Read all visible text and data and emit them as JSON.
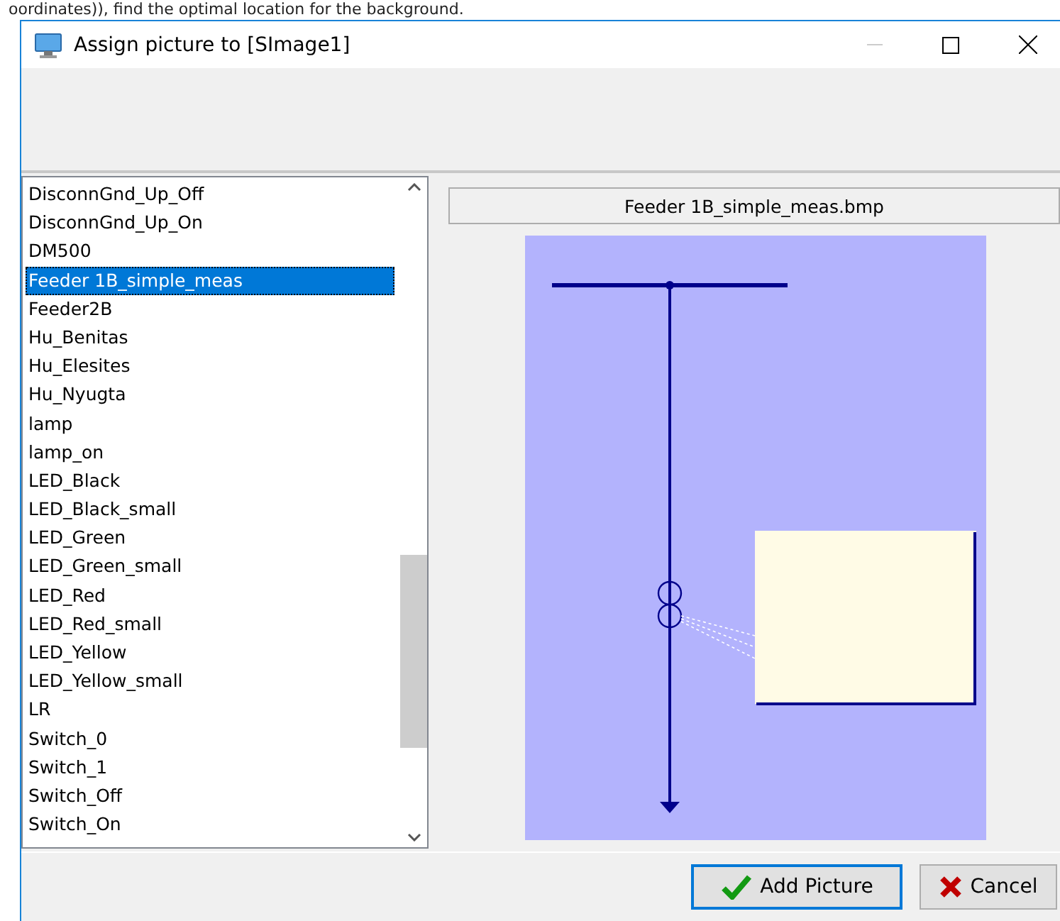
{
  "background_text": "oordinates)), find the optimal location for the background.",
  "window": {
    "title": "Assign picture to [SImage1]"
  },
  "picture_list": {
    "items": [
      {
        "label": "DisconnGnd_Up_Off",
        "selected": false
      },
      {
        "label": "DisconnGnd_Up_On",
        "selected": false
      },
      {
        "label": "DM500",
        "selected": false
      },
      {
        "label": "Feeder 1B_simple_meas",
        "selected": true
      },
      {
        "label": "Feeder2B",
        "selected": false
      },
      {
        "label": "Hu_Benitas",
        "selected": false
      },
      {
        "label": "Hu_Elesites",
        "selected": false
      },
      {
        "label": "Hu_Nyugta",
        "selected": false
      },
      {
        "label": "lamp",
        "selected": false
      },
      {
        "label": "lamp_on",
        "selected": false
      },
      {
        "label": "LED_Black",
        "selected": false
      },
      {
        "label": "LED_Black_small",
        "selected": false
      },
      {
        "label": "LED_Green",
        "selected": false
      },
      {
        "label": "LED_Green_small",
        "selected": false
      },
      {
        "label": "LED_Red",
        "selected": false
      },
      {
        "label": "LED_Red_small",
        "selected": false
      },
      {
        "label": "LED_Yellow",
        "selected": false
      },
      {
        "label": "LED_Yellow_small",
        "selected": false
      },
      {
        "label": "LR",
        "selected": false
      },
      {
        "label": "Switch_0",
        "selected": false
      },
      {
        "label": "Switch_1",
        "selected": false
      },
      {
        "label": "Switch_Off",
        "selected": false
      },
      {
        "label": "Switch_On",
        "selected": false
      }
    ]
  },
  "preview": {
    "file_name": "Feeder 1B_simple_meas.bmp"
  },
  "buttons": [
    {
      "kind": "ok",
      "label": "Add Picture",
      "focused": true
    },
    {
      "kind": "cancel",
      "label": "Cancel",
      "focused": false
    }
  ]
}
